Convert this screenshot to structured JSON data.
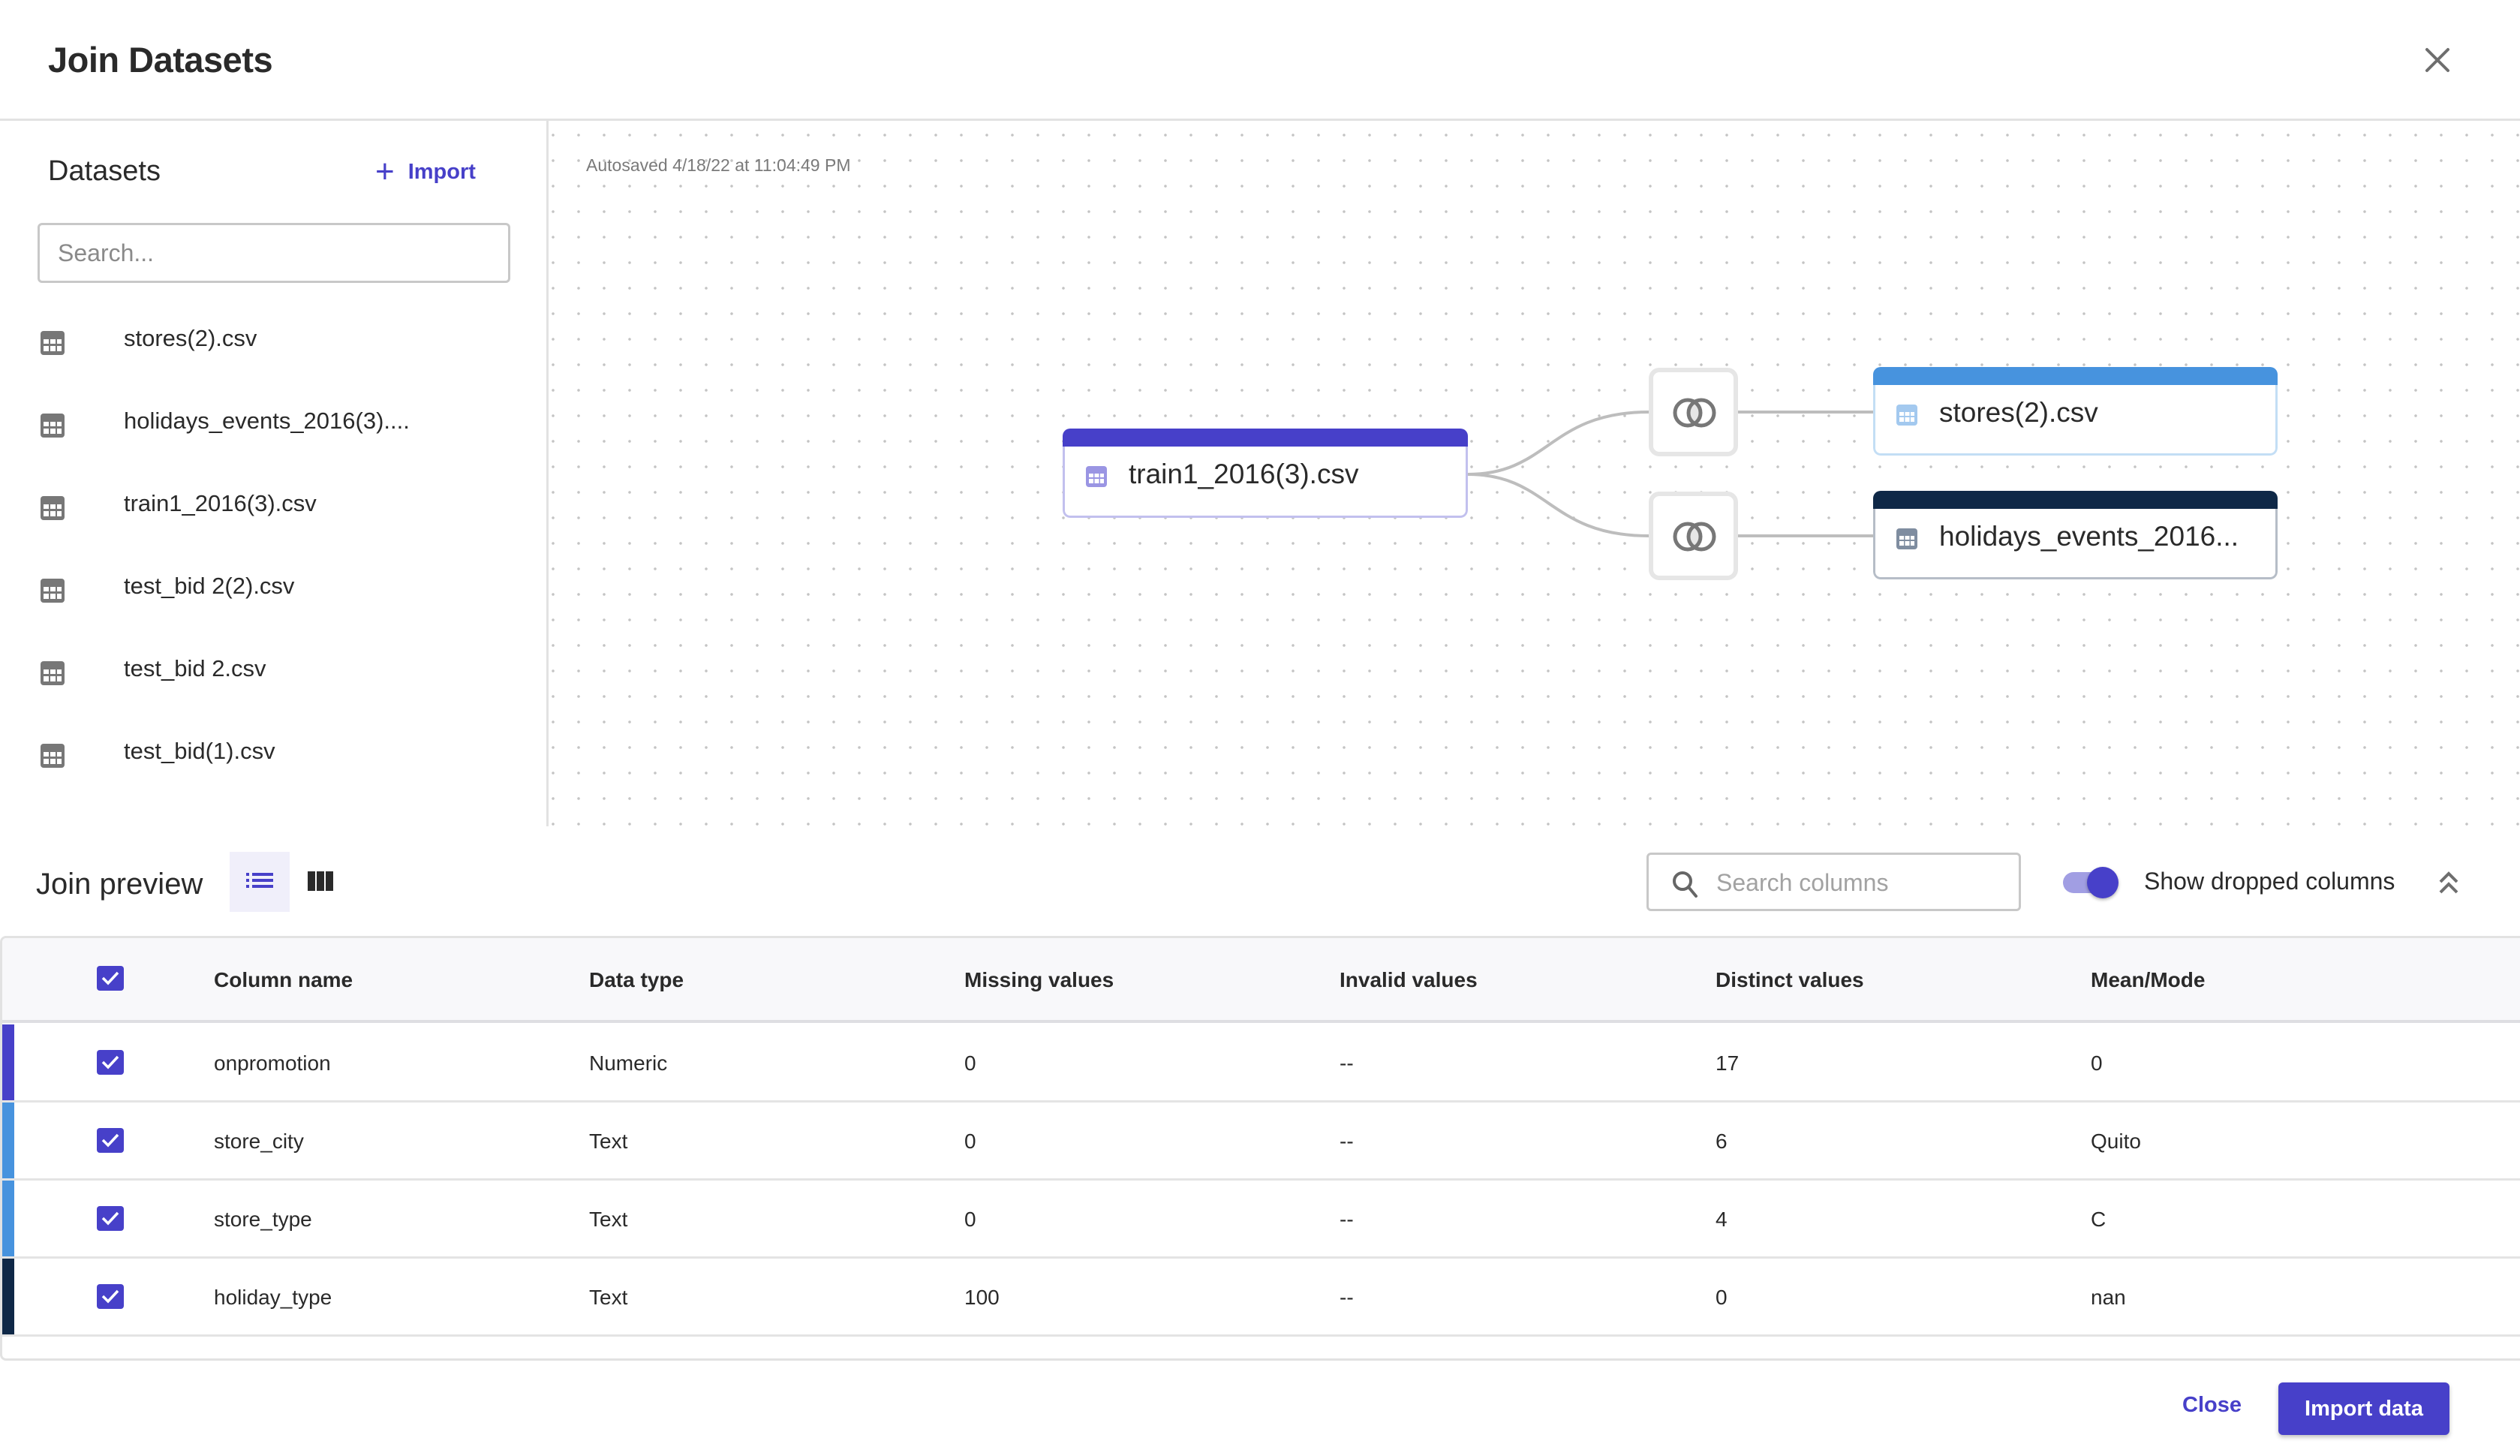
{
  "header": {
    "title": "Join Datasets",
    "close_icon": "close-icon"
  },
  "sidebar": {
    "title": "Datasets",
    "import_label": "Import",
    "import_icon": "plus-icon",
    "search_placeholder": "Search...",
    "search_value": "",
    "items": [
      {
        "label": "stores(2).csv",
        "icon": "table-icon"
      },
      {
        "label": "holidays_events_2016(3)....",
        "icon": "table-icon"
      },
      {
        "label": "train1_2016(3).csv",
        "icon": "table-icon"
      },
      {
        "label": "test_bid 2(2).csv",
        "icon": "table-icon"
      },
      {
        "label": "test_bid 2.csv",
        "icon": "table-icon"
      },
      {
        "label": "test_bid(1).csv",
        "icon": "table-icon"
      }
    ]
  },
  "canvas": {
    "autosave_text": "Autosaved 4/18/22 at 11:04:49 PM",
    "nodes": {
      "source": {
        "label": "train1_2016(3).csv",
        "color": "#4740c9",
        "icon": "table-icon"
      },
      "target1": {
        "label": "stores(2).csv",
        "color": "#4793de",
        "icon": "table-icon"
      },
      "target2": {
        "label": "holidays_events_2016...",
        "color": "#0f2847",
        "icon": "table-icon"
      }
    },
    "joins": [
      {
        "icon": "inner-join-icon",
        "from": "source",
        "to": "target1"
      },
      {
        "icon": "inner-join-icon",
        "from": "source",
        "to": "target2"
      }
    ]
  },
  "preview": {
    "title": "Join preview",
    "view_modes": [
      {
        "name": "list-view",
        "active": true
      },
      {
        "name": "column-view",
        "active": false
      }
    ],
    "search_placeholder": "Search columns",
    "search_value": "",
    "toggle_label": "Show dropped columns",
    "toggle_on": true,
    "collapse_icon": "chevron-double-up-icon"
  },
  "table": {
    "all_selected": true,
    "headers": [
      "Column name",
      "Data type",
      "Missing values",
      "Invalid values",
      "Distinct values",
      "Mean/Mode"
    ],
    "rows": [
      {
        "source_color": "#4740c9",
        "checked": true,
        "cells": [
          "onpromotion",
          "Numeric",
          "0",
          "--",
          "17",
          "0"
        ]
      },
      {
        "source_color": "#4793de",
        "checked": true,
        "cells": [
          "store_city",
          "Text",
          "0",
          "--",
          "6",
          "Quito"
        ]
      },
      {
        "source_color": "#4793de",
        "checked": true,
        "cells": [
          "store_type",
          "Text",
          "0",
          "--",
          "4",
          "C"
        ]
      },
      {
        "source_color": "#0f2847",
        "checked": true,
        "cells": [
          "holiday_type",
          "Text",
          "100",
          "--",
          "0",
          "nan"
        ]
      }
    ]
  },
  "footer": {
    "close_label": "Close",
    "import_label": "Import data"
  },
  "colors": {
    "accent": "#4740c9",
    "stores": "#4793de",
    "holidays": "#0f2847"
  }
}
